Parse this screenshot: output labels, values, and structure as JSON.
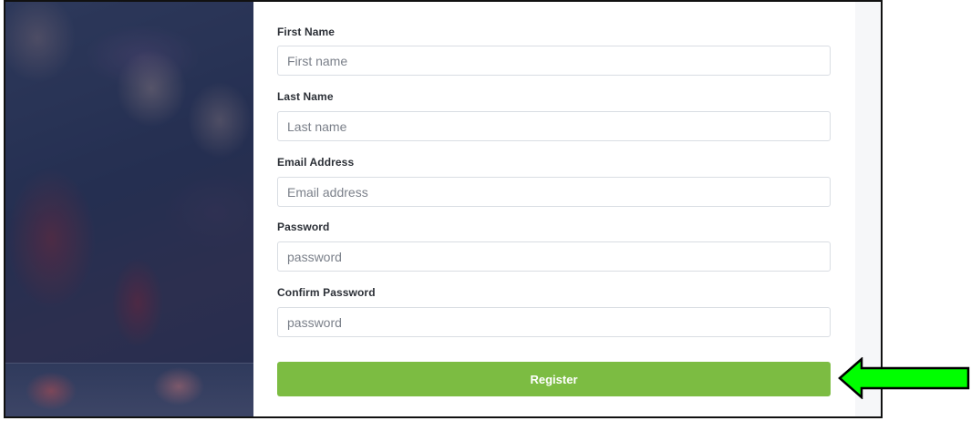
{
  "form": {
    "fields": [
      {
        "label": "First Name",
        "placeholder": "First name"
      },
      {
        "label": "Last Name",
        "placeholder": "Last name"
      },
      {
        "label": "Email Address",
        "placeholder": "Email address"
      },
      {
        "label": "Password",
        "placeholder": "password"
      },
      {
        "label": "Confirm Password",
        "placeholder": "password"
      }
    ],
    "register_label": "Register"
  },
  "colors": {
    "register_button": "#7cbc42",
    "annotation_arrow": "#00ff00"
  },
  "icons": {
    "annotation": "left-arrow-icon",
    "photo": "crowd-fans-photo"
  }
}
